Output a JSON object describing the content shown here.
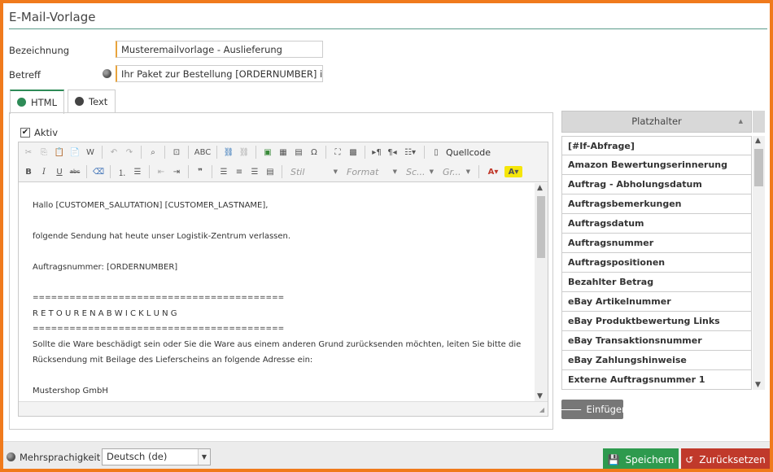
{
  "window": {
    "title": "E-Mail-Vorlage"
  },
  "form": {
    "bezeichnung_label": "Bezeichnung",
    "bezeichnung_value": "Musteremailvorlage - Auslieferung",
    "betreff_label": "Betreff",
    "betreff_value": "Ihr Paket zur Bestellung [ORDERNUMBER] ist u"
  },
  "tabs": [
    {
      "label": "HTML",
      "icon": "globe-icon",
      "active": true
    },
    {
      "label": "Text",
      "icon": "globe-icon",
      "active": false
    }
  ],
  "editor": {
    "aktiv_label": "Aktiv",
    "aktiv_checked": true,
    "toolbar": {
      "source_label": "Quellcode",
      "combo_style": "Stil",
      "combo_format": "Format",
      "combo_font": "Sc...",
      "combo_size": "Gr..."
    },
    "content_lines": [
      "Hallo [CUSTOMER_SALUTATION] [CUSTOMER_LASTNAME],",
      "",
      "folgende Sendung hat heute unser Logistik-Zentrum verlassen.",
      "",
      "Auftragsnummer: [ORDERNUMBER]",
      "",
      "=========================================",
      "R E T O U R E N A B W I C K L U N G",
      "=========================================",
      "Sollte die Ware beschädigt sein oder Sie die Ware aus einem anderen Grund zurücksenden möchten, leiten Sie bitte die",
      "Rücksendung mit Beilage des Lieferscheins an folgende Adresse ein:",
      "",
      "Mustershop GmbH"
    ]
  },
  "placeholders": {
    "header": "Platzhalter",
    "items": [
      "[#If-Abfrage]",
      "Amazon Bewertungserinnerung",
      "Auftrag - Abholungsdatum",
      "Auftragsbemerkungen",
      "Auftragsdatum",
      "Auftragsnummer",
      "Auftragspositionen",
      "Bezahlter Betrag",
      "eBay Artikelnummer",
      "eBay Produktbewertung Links",
      "eBay Transaktionsnummer",
      "eBay Zahlungshinweise",
      "Externe Auftragsnummer 1"
    ],
    "insert_label": "Einfügen"
  },
  "footer": {
    "multilang_label": "Mehrsprachigkeit",
    "language_value": "Deutsch (de)",
    "save_label": "Speichern",
    "reset_label": "Zurücksetzen"
  },
  "colors": {
    "frame": "#f07a1c",
    "save": "#2e9a4e",
    "reset": "#c0392b",
    "accent_rule": "#5a9b8a"
  }
}
